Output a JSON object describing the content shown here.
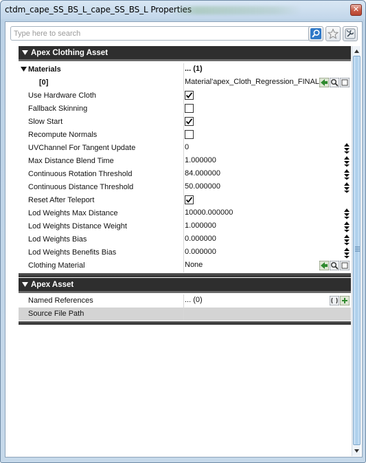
{
  "window": {
    "title": "ctdm_cape_SS_BS_L_cape_SS_BS_L Properties",
    "close_glyph": "✕"
  },
  "search": {
    "placeholder": "Type here to search"
  },
  "toolbar": {
    "icons": [
      "find-icon",
      "favorite-star-icon",
      "settings-wrench-icon"
    ]
  },
  "categories": {
    "clothing": {
      "label": "Apex Clothing Asset",
      "materials": {
        "label": "Materials",
        "value": "... (1)",
        "element": {
          "label": "[0]",
          "value": "Material'apex_Cloth_Regression_FINAL.c"
        }
      },
      "properties": [
        {
          "name": "Use Hardware Cloth",
          "type": "checkbox",
          "checked": true
        },
        {
          "name": "Fallback Skinning",
          "type": "checkbox",
          "checked": false
        },
        {
          "name": "Slow Start",
          "type": "checkbox",
          "checked": true
        },
        {
          "name": "Recompute Normals",
          "type": "checkbox",
          "checked": false
        },
        {
          "name": "UVChannel For Tangent Update",
          "type": "number",
          "value": "0"
        },
        {
          "name": "Max Distance Blend Time",
          "type": "number",
          "value": "1.000000"
        },
        {
          "name": "Continuous Rotation Threshold",
          "type": "number",
          "value": "84.000000"
        },
        {
          "name": "Continuous Distance Threshold",
          "type": "number",
          "value": "50.000000"
        },
        {
          "name": "Reset After Teleport",
          "type": "checkbox",
          "checked": true
        },
        {
          "name": "Lod Weights Max Distance",
          "type": "number",
          "value": "10000.000000"
        },
        {
          "name": "Lod Weights Distance Weight",
          "type": "number",
          "value": "1.000000"
        },
        {
          "name": "Lod Weights Bias",
          "type": "number",
          "value": "0.000000"
        },
        {
          "name": "Lod Weights Benefits Bias",
          "type": "number",
          "value": "0.000000"
        },
        {
          "name": "Clothing Material",
          "type": "object",
          "value": "None"
        }
      ]
    },
    "apex": {
      "label": "Apex Asset",
      "properties": [
        {
          "name": "Named References",
          "value": "... (0)"
        },
        {
          "name": "Source File Path",
          "value": ""
        }
      ]
    }
  },
  "colors": {
    "category_bg": "#2e2e2e",
    "window_frame": "#c6d9ea",
    "scroll_thumb": "#a9cdea"
  }
}
